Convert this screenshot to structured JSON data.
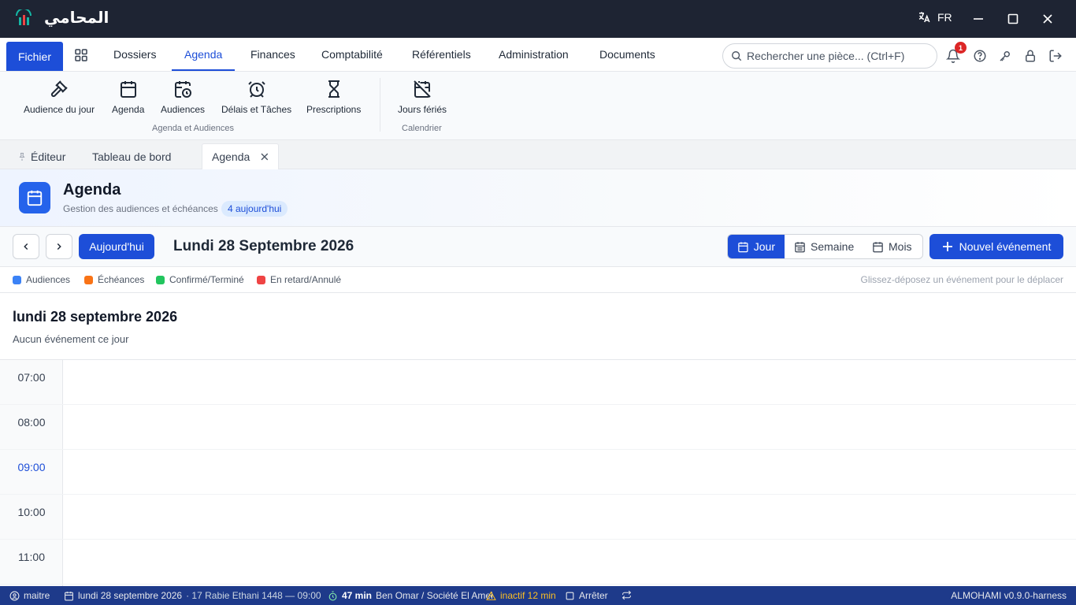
{
  "titlebar": {
    "app_title": "المحامي",
    "lang": "FR"
  },
  "menubar": {
    "fichier": "Fichier",
    "items": [
      {
        "label": "Dossiers"
      },
      {
        "label": "Agenda"
      },
      {
        "label": "Finances"
      },
      {
        "label": "Comptabilité"
      },
      {
        "label": "Référentiels"
      },
      {
        "label": "Administration"
      },
      {
        "label": "Documents"
      }
    ],
    "active": "Agenda",
    "search_placeholder": "Rechercher une pièce... (Ctrl+F)",
    "notification_count": "1"
  },
  "ribbon": {
    "buttons": [
      {
        "label": "Audience du jour",
        "icon": "gavel-icon"
      },
      {
        "label": "Agenda",
        "icon": "calendar-icon"
      },
      {
        "label": "Audiences",
        "icon": "calendar-clock-icon"
      },
      {
        "label": "Délais et Tâches",
        "icon": "alarm-clock-icon"
      },
      {
        "label": "Prescriptions",
        "icon": "hourglass-icon"
      },
      {
        "label": "Jours fériés",
        "icon": "calendar-off-icon"
      }
    ],
    "groups": [
      "Agenda et Audiences",
      "Calendrier"
    ]
  },
  "tabs": [
    {
      "label": "Éditeur",
      "pinned": true
    },
    {
      "label": "Tableau de bord"
    },
    {
      "label": "Agenda",
      "active": true
    }
  ],
  "page_header": {
    "title": "Agenda",
    "subtitle": "Gestion des audiences et échéances",
    "badge": "4 aujourd'hui"
  },
  "toolbar": {
    "today": "Aujourd'hui",
    "date_title": "Lundi 28 Septembre 2026",
    "views": [
      "Jour",
      "Semaine",
      "Mois"
    ],
    "active_view": "Jour",
    "new_event": "Nouvel événement"
  },
  "legend": {
    "items": [
      {
        "label": "Audiences",
        "color": "#3b82f6"
      },
      {
        "label": "Échéances",
        "color": "#f97316"
      },
      {
        "label": "Confirmé/Terminé",
        "color": "#22c55e"
      },
      {
        "label": "En retard/Annulé",
        "color": "#ef4444"
      }
    ],
    "hint": "Glissez-déposez un événement pour le déplacer"
  },
  "day": {
    "title": "lundi 28 septembre 2026",
    "empty": "Aucun événement ce jour",
    "hours": [
      "07:00",
      "08:00",
      "09:00",
      "10:00",
      "11:00"
    ],
    "current_hour": "09:00"
  },
  "statusbar": {
    "user": "maitre",
    "date": "lundi 28 septembre 2026",
    "hijri": "· 17 Rabie Ethani 1448 — 09:00",
    "timer": "47 min",
    "client": "Ben Omar / Société El Amel",
    "inactive": "inactif 12 min",
    "stop": "Arrêter",
    "version": "ALMOHAMI v0.9.0-harness"
  }
}
